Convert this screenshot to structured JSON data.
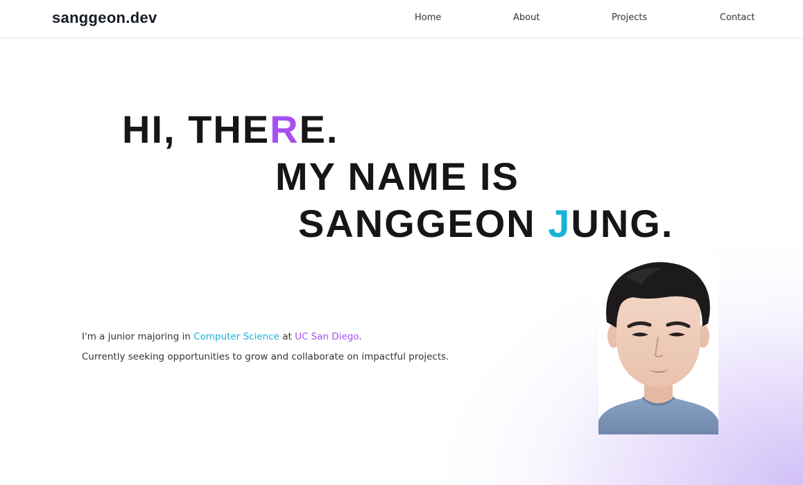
{
  "nav": {
    "brand": "sanggeon.dev",
    "links": [
      {
        "label": "Home"
      },
      {
        "label": "About"
      },
      {
        "label": "Projects"
      },
      {
        "label": "Contact"
      }
    ]
  },
  "hero": {
    "line1": {
      "before": "HI, THE",
      "accent": "R",
      "after": "E."
    },
    "line2": "MY NAME IS",
    "line3": {
      "before": "SANGGEON ",
      "accent": "J",
      "after": "UNG."
    }
  },
  "intro": {
    "line1": {
      "prefix": "I'm a junior majoring in ",
      "major": "Computer Science",
      "middle": " at ",
      "school": "UC San Diego",
      "suffix": "."
    },
    "line2": "Currently seeking opportunities to grow and collaborate on impactful projects."
  },
  "theme": {
    "accent_purple": "#a64ff2",
    "accent_cyan": "#17b3d9",
    "text_dark": "#161616",
    "glow": "#cebcf7"
  },
  "portrait": {
    "icon": "profile-photo"
  }
}
